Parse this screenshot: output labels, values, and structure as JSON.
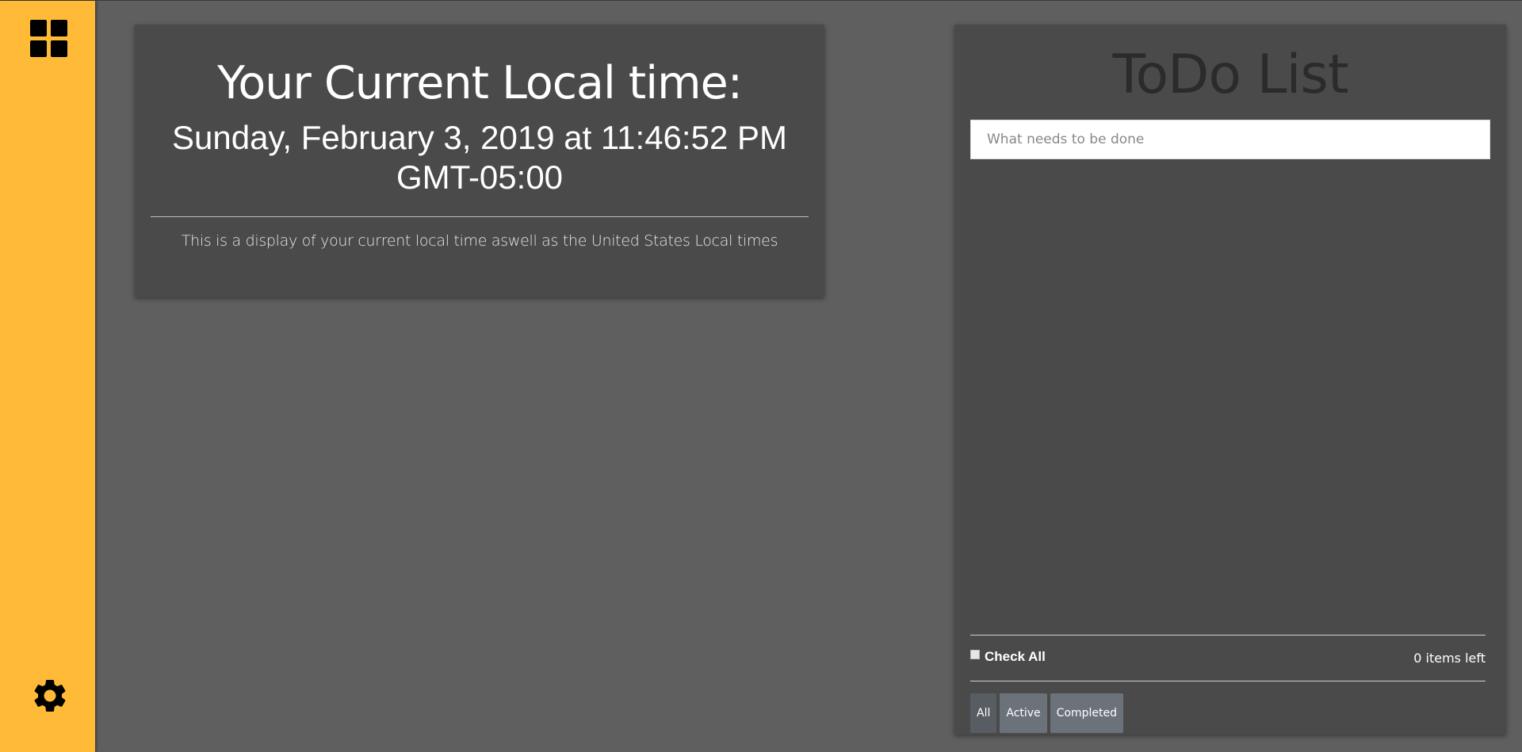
{
  "sidebar": {
    "top_icon": "grid-icon",
    "bottom_icon": "gear-icon",
    "accent": "#ffba37"
  },
  "time_card": {
    "title": "Your Current Local time:",
    "datetime_line1": "Sunday, February 3, 2019 at 11:46:52 PM",
    "datetime_line2": "GMT-05:00",
    "description": "This is a display of your current local time aswell as the United States Local times"
  },
  "todo": {
    "title": "ToDo List",
    "input_placeholder": "What needs to be done",
    "check_all_label": "Check All",
    "items_left": "0 items left",
    "filters": [
      "All",
      "Active",
      "Completed"
    ],
    "active_filter": "All"
  }
}
